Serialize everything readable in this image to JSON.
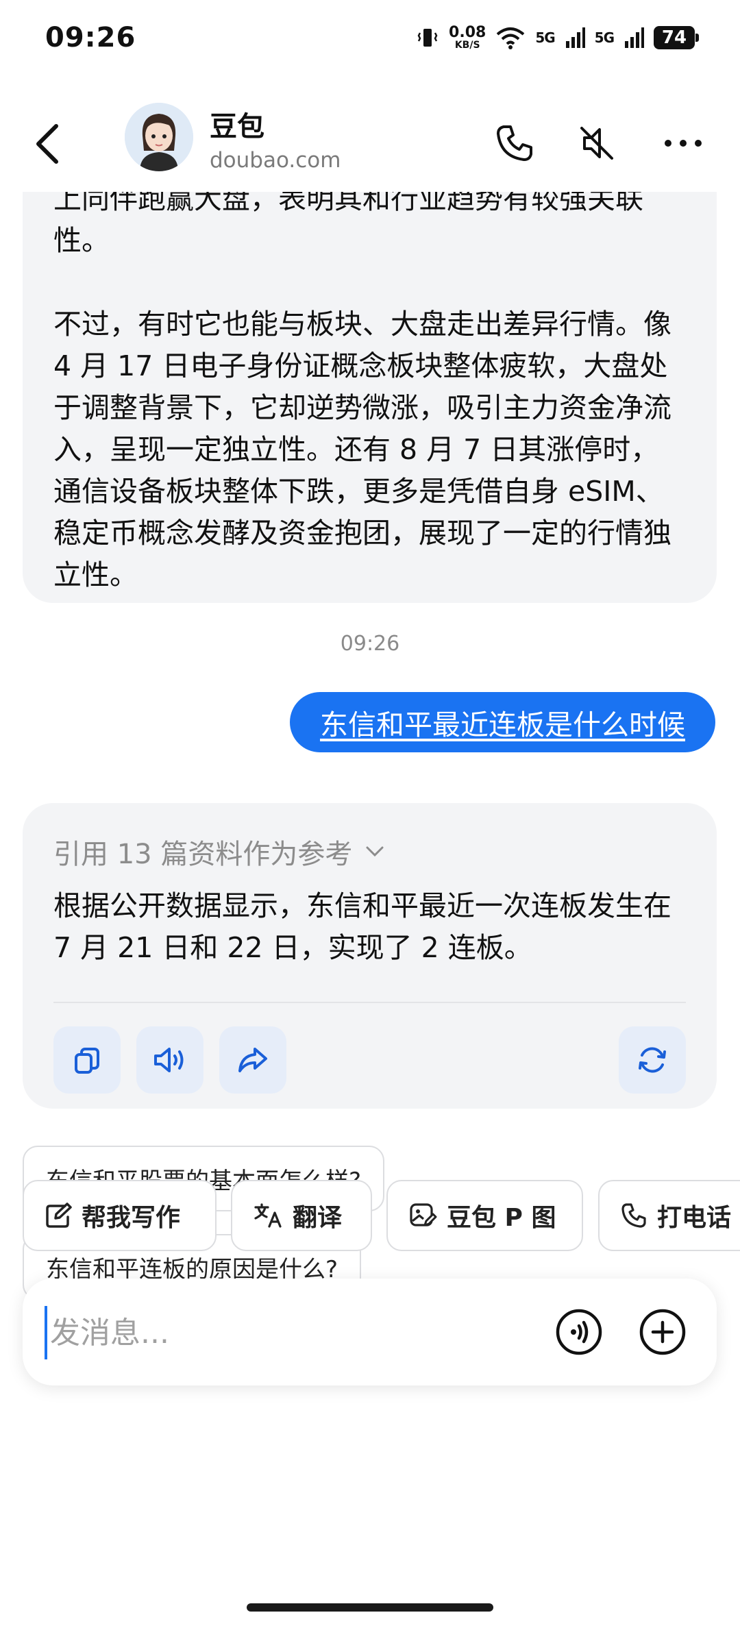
{
  "status_bar": {
    "time": "09:26",
    "net_speed_value": "0.08",
    "net_speed_unit": "KB/S",
    "signal_1": "5G",
    "signal_2": "5G",
    "battery": "74"
  },
  "header": {
    "bot_name": "豆包",
    "bot_domain": "doubao.com"
  },
  "messages": {
    "previous_bot": {
      "para_1": "上同伴跑赢大盘，表明其和行业趋势有较强关联性。",
      "para_2": "不过，有时它也能与板块、大盘走出差异行情。像 4 月 17 日电子身份证概念板块整体疲软，大盘处于调整背景下，它却逆势微涨，吸引主力资金净流入，呈现一定独立性。还有 8 月 7 日其涨停时，通信设备板块整体下跌，更多是凭借自身 eSIM、稳定币概念发酵及资金抱团，展现了一定的行情独立性。"
    },
    "timestamp": "09:26",
    "user_message": "东信和平最近连板是什么时候",
    "bot_reply": {
      "references_label": "引用 13 篇资料作为参考",
      "answer": "根据公开数据显示，东信和平最近一次连板发生在 7 月 21 日和 22 日，实现了 2 连板。"
    },
    "suggestions": [
      "东信和平股票的基本面怎么样?",
      "东信和平连板的原因是什么?"
    ]
  },
  "quick_tools": [
    {
      "label": "帮我写作",
      "icon": "edit-icon"
    },
    {
      "label": "翻译",
      "icon": "translate-icon"
    },
    {
      "label": "豆包 P 图",
      "icon": "image-edit-icon"
    },
    {
      "label": "打电话",
      "icon": "phone-icon"
    }
  ],
  "input": {
    "placeholder": "发消息..."
  },
  "colors": {
    "accent": "#1a73f2",
    "bubble_bg": "#f3f4f6",
    "action_btn_bg": "#e6edf9"
  }
}
